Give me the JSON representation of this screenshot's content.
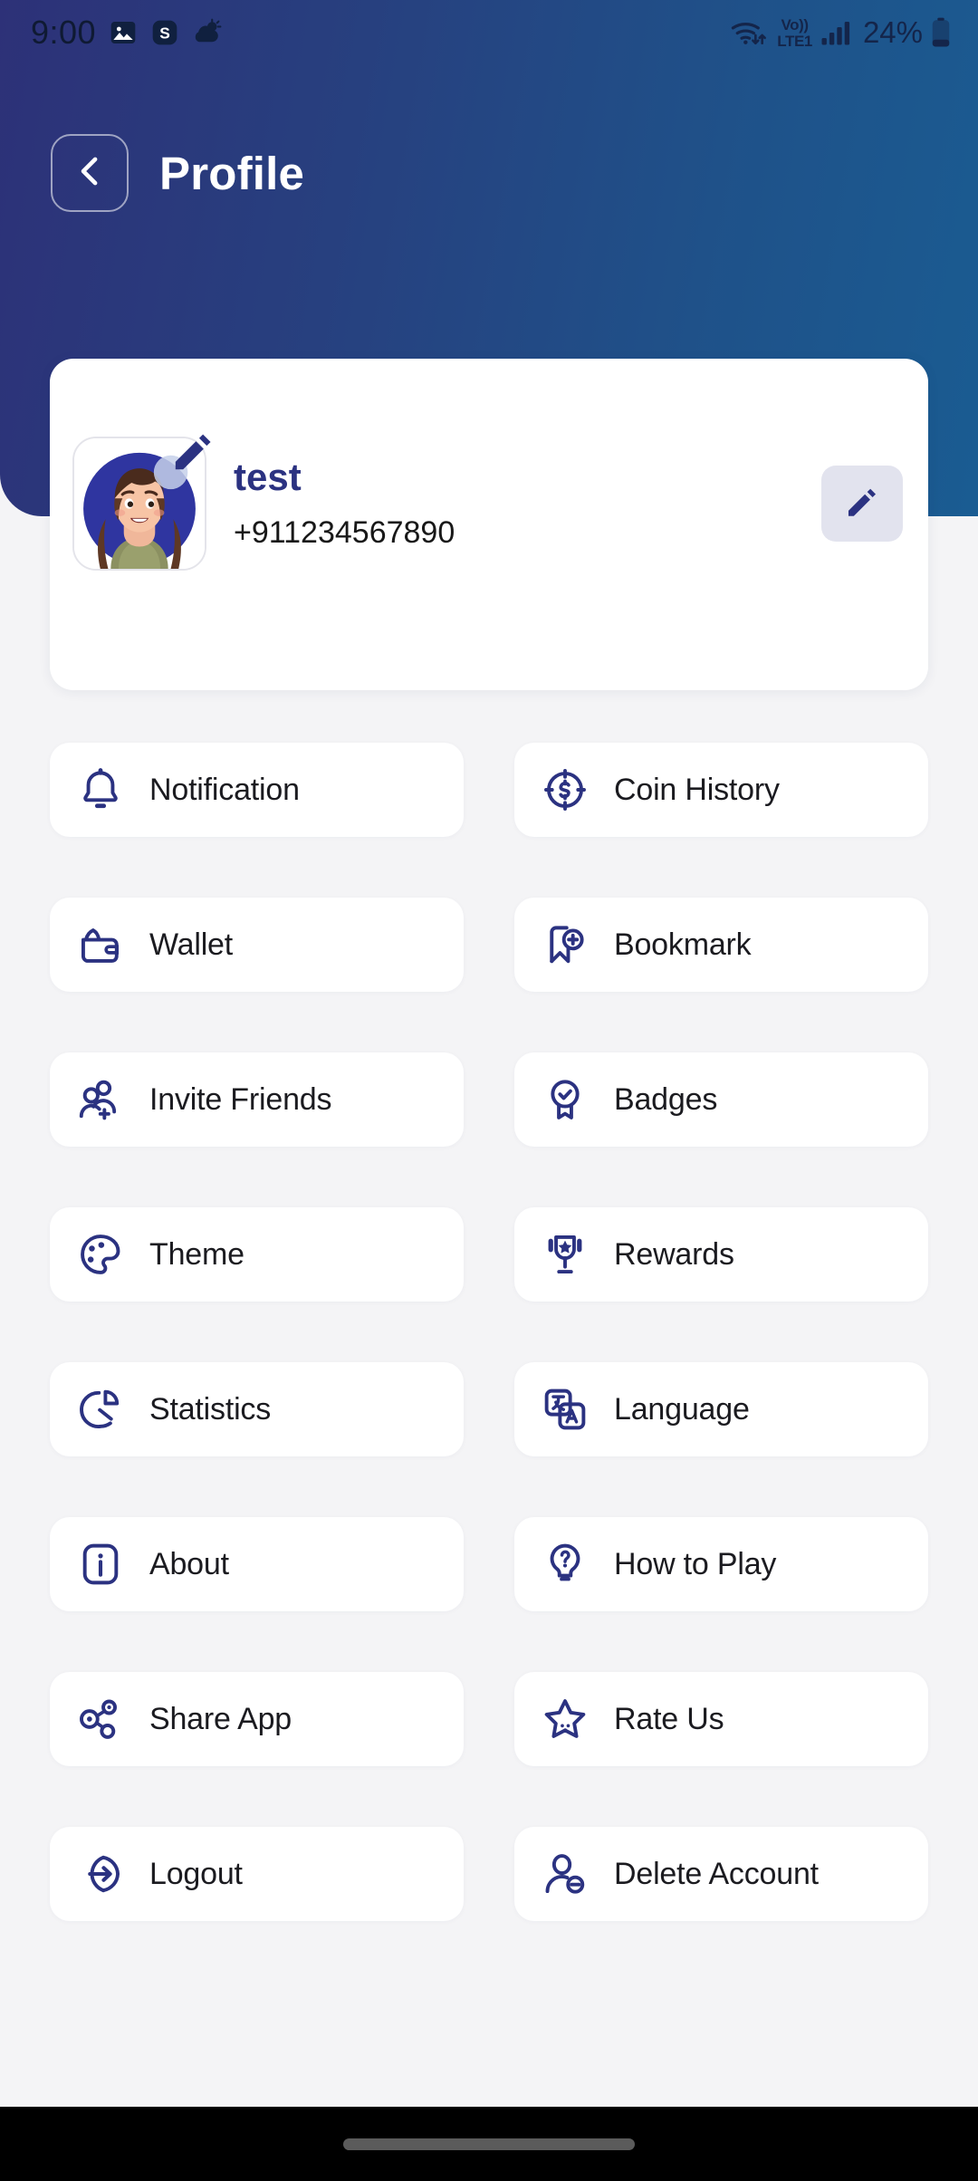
{
  "status_bar": {
    "time": "9:00",
    "left_icons": [
      "image-icon",
      "skype-icon",
      "weather-icon"
    ],
    "volte_line1": "Vo))",
    "volte_line2": "LTE1",
    "right_icons": [
      "wifi-icon",
      "signal-icon",
      "battery-icon"
    ],
    "battery_percent": "24%"
  },
  "header": {
    "title": "Profile",
    "back_icon": "chevron-left-icon",
    "gradient_start": "#2d3178",
    "gradient_end": "#1a5c92"
  },
  "profile": {
    "avatar_alt": "user-avatar",
    "avatar_edit_badge": "pencil-badge-icon",
    "name": "test",
    "phone": "+911234567890",
    "edit_button_icon": "pencil-icon",
    "name_color": "#2b3281"
  },
  "menu": {
    "items": [
      {
        "label": "Notification",
        "icon": "bell-icon"
      },
      {
        "label": "Coin History",
        "icon": "coin-target-icon"
      },
      {
        "label": "Wallet",
        "icon": "wallet-icon"
      },
      {
        "label": "Bookmark",
        "icon": "bookmark-plus-icon"
      },
      {
        "label": "Invite Friends",
        "icon": "user-add-icon"
      },
      {
        "label": "Badges",
        "icon": "badge-check-icon"
      },
      {
        "label": "Theme",
        "icon": "palette-icon"
      },
      {
        "label": "Rewards",
        "icon": "trophy-star-icon"
      },
      {
        "label": "Statistics",
        "icon": "pie-chart-icon"
      },
      {
        "label": "Language",
        "icon": "translate-icon"
      },
      {
        "label": "About",
        "icon": "info-icon"
      },
      {
        "label": "How to Play",
        "icon": "lightbulb-question-icon"
      },
      {
        "label": "Share App",
        "icon": "share-nodes-icon"
      },
      {
        "label": "Rate Us",
        "icon": "star-icon"
      },
      {
        "label": "Logout",
        "icon": "logout-icon"
      },
      {
        "label": "Delete Account",
        "icon": "user-minus-icon"
      }
    ],
    "icon_color": "#2b3281",
    "card_background": "#ffffff"
  },
  "navigation_bar": {
    "home_indicator": "home-indicator-pill"
  }
}
